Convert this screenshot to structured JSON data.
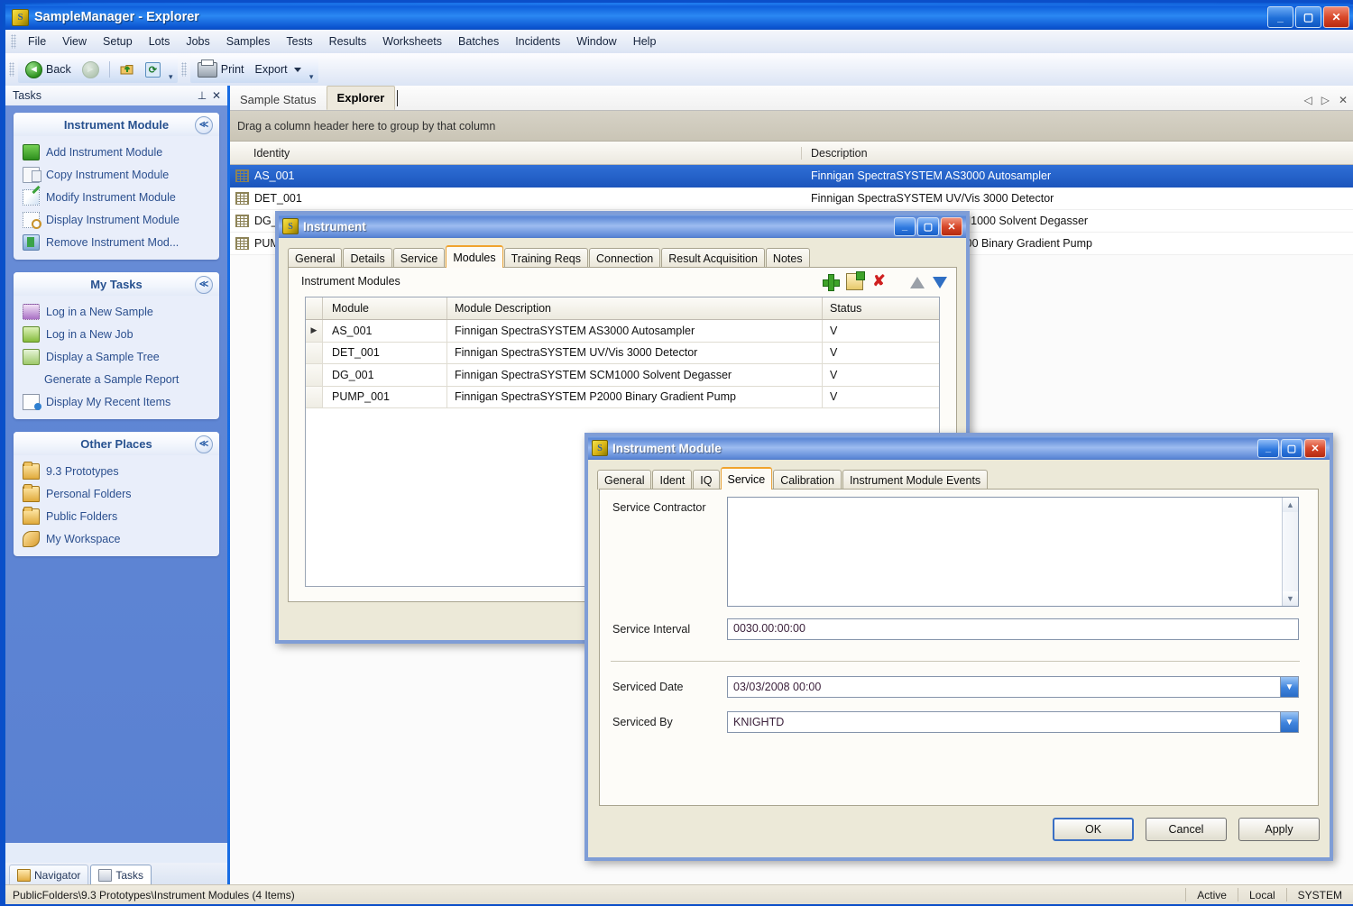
{
  "window": {
    "title": "SampleManager - Explorer",
    "icon": "sm-logo-icon",
    "minimize": "_",
    "maximize": "▢",
    "close": "✕"
  },
  "menu": {
    "items": [
      {
        "label": "File",
        "accel": "F"
      },
      {
        "label": "View",
        "accel": "V"
      },
      {
        "label": "Setup",
        "accel": ""
      },
      {
        "label": "Lots",
        "accel": ""
      },
      {
        "label": "Jobs",
        "accel": ""
      },
      {
        "label": "Samples",
        "accel": ""
      },
      {
        "label": "Tests",
        "accel": ""
      },
      {
        "label": "Results",
        "accel": ""
      },
      {
        "label": "Worksheets",
        "accel": ""
      },
      {
        "label": "Batches",
        "accel": ""
      },
      {
        "label": "Incidents",
        "accel": ""
      },
      {
        "label": "Window",
        "accel": "W"
      },
      {
        "label": "Help",
        "accel": "H"
      }
    ]
  },
  "toolbar": {
    "back_label": "Back",
    "forward_label": "",
    "up_label": "",
    "refresh_label": "",
    "print_label": "Print",
    "export_label": "Export",
    "overflow": "▾"
  },
  "tasks_pane": {
    "title": "Tasks",
    "pin": "⊥",
    "close": "✕",
    "groups": [
      {
        "title": "Instrument Module",
        "collapse": "≪",
        "items": [
          {
            "label": "Add Instrument Module",
            "icon": "add-module-icon"
          },
          {
            "label": "Copy Instrument Module",
            "icon": "copy-module-icon"
          },
          {
            "label": "Modify Instrument Module",
            "icon": "modify-module-icon"
          },
          {
            "label": "Display Instrument Module",
            "icon": "display-module-icon"
          },
          {
            "label": "Remove Instrument Mod...",
            "icon": "remove-module-icon"
          }
        ]
      },
      {
        "title": "My Tasks",
        "collapse": "≪",
        "items": [
          {
            "label": "Log in a New Sample",
            "icon": "flask-icon"
          },
          {
            "label": "Log in a New Job",
            "icon": "job-icon"
          },
          {
            "label": "Display a Sample Tree",
            "icon": "sample-tree-icon"
          },
          {
            "label": "Generate a Sample Report",
            "icon": "none"
          },
          {
            "label": "Display My Recent Items",
            "icon": "recent-items-icon"
          }
        ]
      },
      {
        "title": "Other Places",
        "collapse": "≪",
        "items": [
          {
            "label": "9.3 Prototypes",
            "icon": "folder-icon"
          },
          {
            "label": "Personal Folders",
            "icon": "folder-icon"
          },
          {
            "label": "Public Folders",
            "icon": "folder-icon"
          },
          {
            "label": "My Workspace",
            "icon": "workspace-icon"
          }
        ]
      }
    ],
    "footer_tabs": [
      {
        "label": "Navigator",
        "active": false,
        "icon": "navigator-icon"
      },
      {
        "label": "Tasks",
        "active": true,
        "icon": "tasks-clipboard-icon"
      }
    ]
  },
  "content": {
    "tabs": [
      {
        "label": "Sample Status",
        "active": false
      },
      {
        "label": "Explorer",
        "active": true
      }
    ],
    "tab_nav": {
      "prev": "◁",
      "next": "▷",
      "close": "✕"
    },
    "group_hint": "Drag a column header here to group by that column",
    "columns": [
      "Identity",
      "Description"
    ],
    "rows": [
      {
        "identity": "AS_001",
        "description": "Finnigan SpectraSYSTEM AS3000 Autosampler",
        "selected": true
      },
      {
        "identity": "DET_001",
        "description": "Finnigan SpectraSYSTEM UV/Vis 3000 Detector",
        "selected": false
      },
      {
        "identity": "DG_001",
        "description": "Finnigan SpectraSYSTEM SCM1000 Solvent Degasser",
        "selected": false
      },
      {
        "identity": "PUMP_001",
        "description": "Finnigan SpectraSYSTEM P2000 Binary Gradient Pump",
        "selected": false
      }
    ]
  },
  "instrument_dialog": {
    "title": "Instrument",
    "icon": "sm-logo-icon",
    "minimize": "_",
    "maximize": "▢",
    "close": "✕",
    "tabs": [
      {
        "label": "General",
        "active": false
      },
      {
        "label": "Details",
        "active": false
      },
      {
        "label": "Service",
        "active": false
      },
      {
        "label": "Modules",
        "active": true
      },
      {
        "label": "Training Reqs",
        "active": false
      },
      {
        "label": "Connection",
        "active": false
      },
      {
        "label": "Result Acquisition",
        "active": false
      },
      {
        "label": "Notes",
        "active": false
      }
    ],
    "section_title": "Instrument Modules",
    "actions": [
      {
        "name": "add-icon",
        "glyph": "+"
      },
      {
        "name": "add-from-grid-icon",
        "glyph": "▦"
      },
      {
        "name": "delete-icon",
        "glyph": "✘"
      },
      {
        "name": "move-up-icon",
        "glyph": "▲"
      },
      {
        "name": "move-down-icon",
        "glyph": "▼"
      }
    ],
    "grid_columns": [
      "Module",
      "Module Description",
      "Status"
    ],
    "grid_rows": [
      {
        "marker": "▶",
        "module": "AS_001",
        "description": "Finnigan SpectraSYSTEM AS3000 Autosampler",
        "status": "V"
      },
      {
        "marker": "",
        "module": "DET_001",
        "description": "Finnigan SpectraSYSTEM UV/Vis 3000 Detector",
        "status": "V"
      },
      {
        "marker": "",
        "module": "DG_001",
        "description": "Finnigan SpectraSYSTEM SCM1000 Solvent Degasser",
        "status": "V"
      },
      {
        "marker": "",
        "module": "PUMP_001",
        "description": "Finnigan SpectraSYSTEM P2000 Binary Gradient Pump",
        "status": "V"
      }
    ]
  },
  "module_dialog": {
    "title": "Instrument Module",
    "icon": "sm-logo-icon",
    "minimize": "_",
    "maximize": "▢",
    "close": "✕",
    "tabs": [
      {
        "label": "General",
        "active": false
      },
      {
        "label": "Ident",
        "active": false
      },
      {
        "label": "IQ",
        "active": false
      },
      {
        "label": "Service",
        "active": true
      },
      {
        "label": "Calibration",
        "active": false
      },
      {
        "label": "Instrument Module Events",
        "active": false
      }
    ],
    "fields": {
      "service_contractor_label": "Service Contractor",
      "service_contractor_value": "",
      "service_interval_label": "Service Interval",
      "service_interval_value": "0030.00:00:00",
      "serviced_date_label": "Serviced Date",
      "serviced_date_value": "03/03/2008 00:00",
      "serviced_by_label": "Serviced By",
      "serviced_by_value": "KNIGHTD"
    },
    "scroll": {
      "up": "▲",
      "down": "▼"
    },
    "buttons": {
      "ok": "OK",
      "cancel": "Cancel",
      "apply": "Apply"
    }
  },
  "statusbar": {
    "path": "PublicFolders\\9.3 Prototypes\\Instrument Modules (4 Items)",
    "cells": [
      "Active",
      "Local",
      "SYSTEM"
    ]
  }
}
